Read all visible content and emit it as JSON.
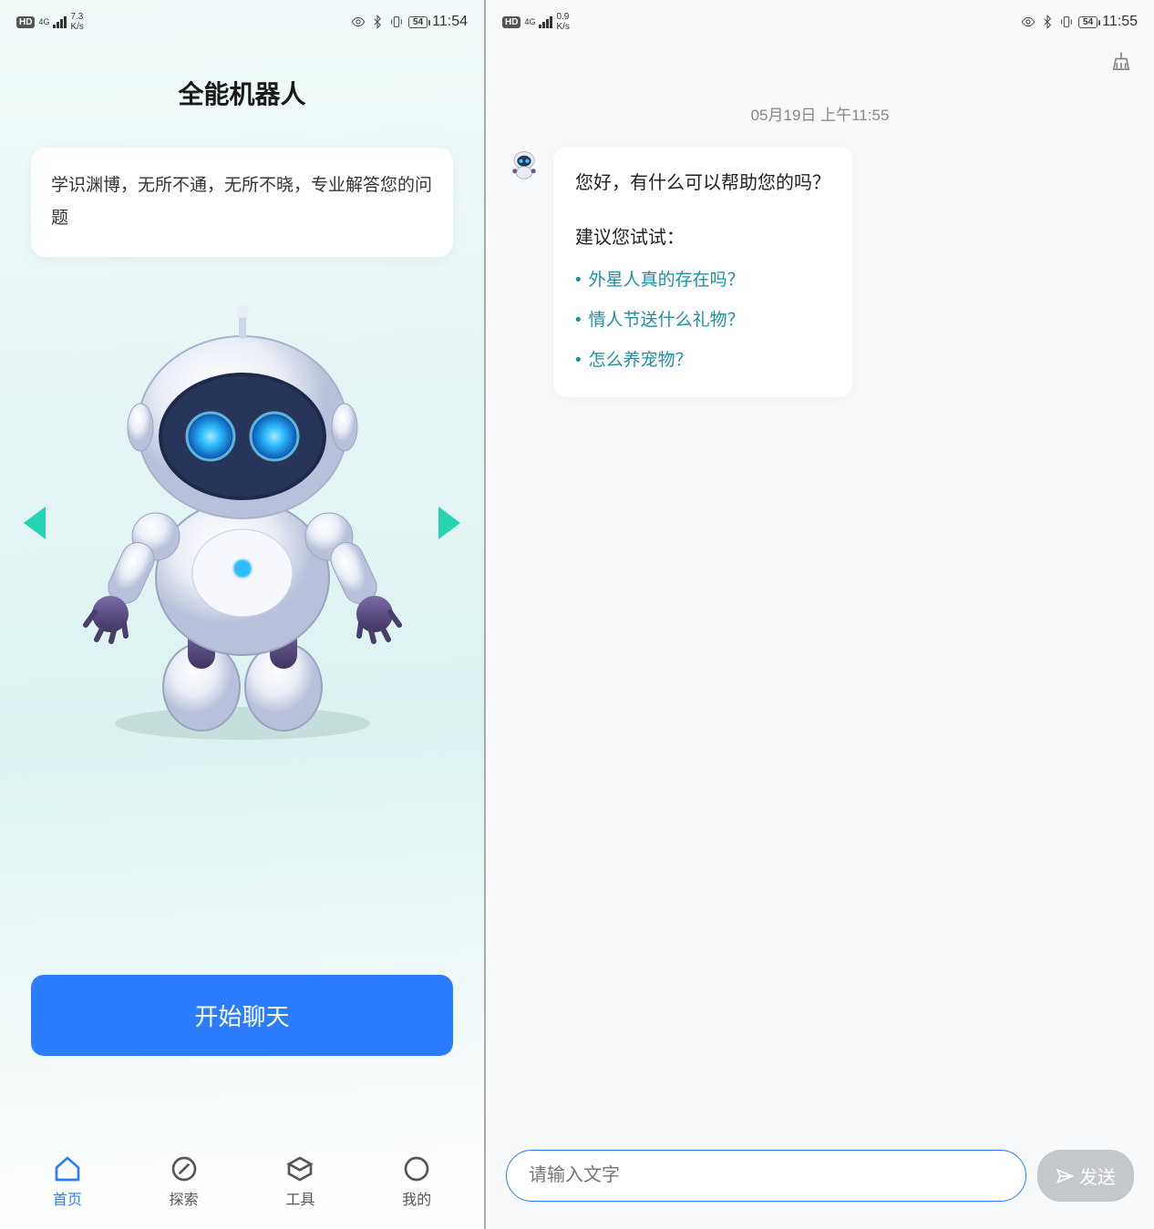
{
  "left": {
    "status": {
      "hd": "HD",
      "net": "4G",
      "speed_top": "7.3",
      "speed_bot": "K/s",
      "battery": "54",
      "time": "11:54"
    },
    "title": "全能机器人",
    "desc": "学识渊博，无所不通，无所不晓，专业解答您的问题",
    "cta": "开始聊天",
    "nav": {
      "home": "首页",
      "explore": "探索",
      "tools": "工具",
      "mine": "我的"
    }
  },
  "right": {
    "status": {
      "hd": "HD",
      "net": "4G",
      "speed_top": "0.9",
      "speed_bot": "K/s",
      "battery": "54",
      "time": "11:55"
    },
    "timestamp": "05月19日 上午11:55",
    "chat": {
      "greeting": "您好，有什么可以帮助您的吗？",
      "prompt": "建议您试试：",
      "suggestions": [
        "外星人真的存在吗？",
        "情人节送什么礼物？",
        "怎么养宠物？"
      ]
    },
    "input": {
      "placeholder": "请输入文字",
      "send": "发送"
    }
  }
}
